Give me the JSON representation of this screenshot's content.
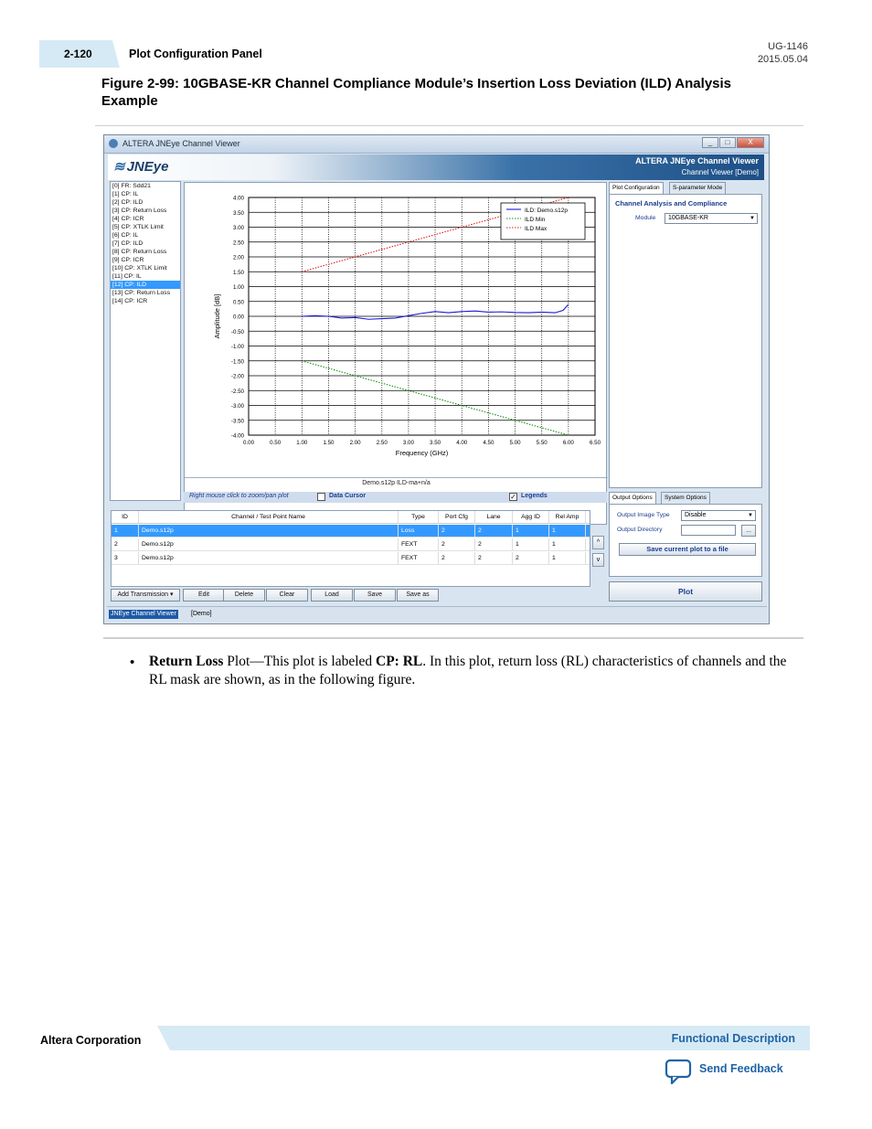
{
  "header": {
    "page_number": "2-120",
    "section": "Plot Configuration Panel",
    "doc_id": "UG-1146",
    "doc_date": "2015.05.04"
  },
  "figure_title": "Figure 2-99: 10GBASE-KR Channel Compliance Module’s Insertion Loss Deviation (ILD) Analysis Example",
  "window": {
    "title": "ALTERA JNEye Channel Viewer",
    "logo": "JNEye",
    "banner_title": "ALTERA JNEye Channel Viewer",
    "banner_subtitle": "Channel Viewer [Demo]",
    "controls": [
      "_",
      "□",
      "X"
    ]
  },
  "plot_list": [
    "[0] FR: Sdd21",
    "[1] CP: IL",
    "[2] CP: ILD",
    "[3] CP: Return Loss",
    "[4] CP: ICR",
    "[5] CP: XTLK Limit",
    "[6] CP: IL",
    "[7] CP: ILD",
    "[8] CP: Return Loss",
    "[9] CP: ICR",
    "[10] CP: XTLK Limit",
    "[11] CP: IL",
    "[12] CP: ILD",
    "[13] CP: Return Loss",
    "[14] CP: ICR"
  ],
  "plot_list_selected": 12,
  "chart_data": {
    "type": "line",
    "title": "",
    "xlabel": "Frequency (GHz)",
    "ylabel": "Amplitude [dB]",
    "xlim": [
      0,
      6.5
    ],
    "ylim": [
      -4,
      4
    ],
    "x_ticks": [
      "0.00",
      "0.50",
      "1.00",
      "1.50",
      "2.00",
      "2.50",
      "3.00",
      "3.50",
      "4.00",
      "4.50",
      "5.00",
      "5.50",
      "6.00",
      "6.50"
    ],
    "y_ticks": [
      "4.00",
      "3.50",
      "3.00",
      "2.50",
      "2.00",
      "1.50",
      "1.00",
      "0.50",
      "0.00",
      "-0.50",
      "-1.00",
      "-1.50",
      "-2.00",
      "-2.50",
      "-3.00",
      "-3.50",
      "-4.00"
    ],
    "grid": true,
    "legend_position": "top-right",
    "footer_label": "Demo.s12p ILD-ma+n/a",
    "series": [
      {
        "name": "ILD: Demo.s12p",
        "color": "#1a1ad6",
        "style": "solid",
        "x": [
          1.0,
          1.25,
          1.5,
          1.75,
          2.0,
          2.25,
          2.5,
          2.75,
          3.0,
          3.25,
          3.5,
          3.75,
          4.0,
          4.25,
          4.5,
          4.75,
          5.0,
          5.25,
          5.5,
          5.75,
          5.9,
          6.0
        ],
        "y": [
          0.0,
          0.02,
          0.0,
          -0.06,
          -0.04,
          -0.1,
          -0.08,
          -0.06,
          0.02,
          0.1,
          0.16,
          0.12,
          0.16,
          0.18,
          0.14,
          0.15,
          0.13,
          0.12,
          0.14,
          0.12,
          0.2,
          0.4
        ]
      },
      {
        "name": "ILD Min",
        "color": "#109010",
        "style": "dotted",
        "x": [
          1.0,
          6.0
        ],
        "y": [
          -1.5,
          -4.0
        ]
      },
      {
        "name": "ILD Max",
        "color": "#e01818",
        "style": "dotted",
        "x": [
          1.0,
          6.0
        ],
        "y": [
          1.5,
          4.0
        ]
      }
    ]
  },
  "plot_options": {
    "hint": "Right mouse click to zoom/pan plot",
    "data_cursor_label": "Data Cursor",
    "data_cursor_checked": false,
    "legends_label": "Legends",
    "legends_checked": true
  },
  "channel_table": {
    "columns": [
      "ID",
      "Channel / Test Point Name",
      "Type",
      "Port Cfg",
      "Lane",
      "Agg ID",
      "Rel Amp"
    ],
    "rows": [
      [
        "1",
        "Demo.s12p",
        "Loss",
        "2",
        "2",
        "1",
        "1"
      ],
      [
        "2",
        "Demo.s12p",
        "FEXT",
        "2",
        "2",
        "1",
        "1"
      ],
      [
        "3",
        "Demo.s12p",
        "FEXT",
        "2",
        "2",
        "2",
        "1"
      ]
    ],
    "selected_row": 0,
    "up_arrow": "^",
    "down_arrow": "v"
  },
  "table_buttons": {
    "add": "Add Transmission",
    "edit": "Edit",
    "delete": "Delete",
    "clear": "Clear",
    "load": "Load",
    "save": "Save",
    "save_as": "Save as"
  },
  "statusbar": {
    "app_label": "JNEye Channel Viewer",
    "mode": "[Demo]"
  },
  "config_panel": {
    "tabs": [
      "Plot Configuration",
      "S-parameter Mode"
    ],
    "active_tab": 0,
    "title": "Channel Analysis and Compliance",
    "module_label": "Module",
    "module_value": "10GBASE-KR"
  },
  "output_panel": {
    "tabs": [
      "Output Options",
      "System Options"
    ],
    "active_tab": 0,
    "image_type_label": "Output Image Type",
    "image_type_value": "Disable",
    "directory_label": "Output Directory",
    "directory_value": "",
    "browse_label": "...",
    "save_plot_label": "Save current plot to a file",
    "plot_button": "Plot"
  },
  "body": {
    "term": "Return Loss",
    "text1": " Plot—This plot is labeled ",
    "label": "CP: RL",
    "text2": ". In this plot, return loss (RL) characteristics of channels and the RL mask are shown, as in the following figure."
  },
  "footer": {
    "company": "Altera Corporation",
    "section_link": "Functional Description",
    "feedback": "Send Feedback"
  }
}
